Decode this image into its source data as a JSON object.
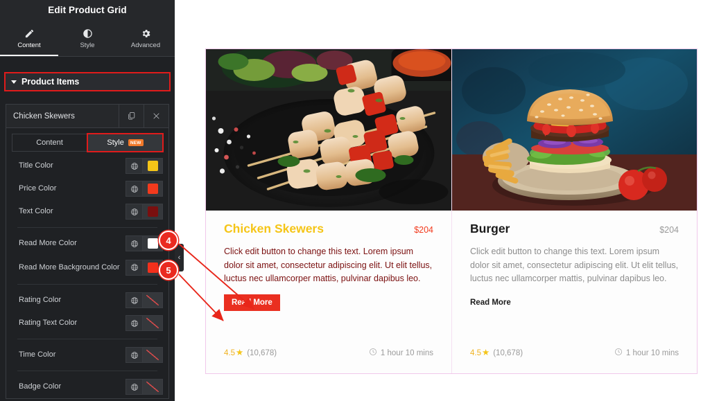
{
  "panel": {
    "title": "Edit Product Grid",
    "tabs": [
      {
        "label": "Content",
        "icon": "pencil-icon",
        "active": true
      },
      {
        "label": "Style",
        "icon": "contrast-icon",
        "active": false
      },
      {
        "label": "Advanced",
        "icon": "gear-icon",
        "active": false
      }
    ],
    "section": {
      "label": "Product Items",
      "caret": "caret-down-icon"
    },
    "item": {
      "name": "Chicken Skewers",
      "duplicate_icon": "duplicate-icon",
      "close_icon": "close-icon"
    },
    "subtabs": [
      {
        "label": "Content",
        "selected": false
      },
      {
        "label": "Style",
        "selected": true,
        "badge": "NEW"
      }
    ],
    "controls": [
      {
        "label": "Title Color",
        "swatch": "#f5c518",
        "empty": false,
        "divider_after": false
      },
      {
        "label": "Price Color",
        "swatch": "#f23a1d",
        "empty": false,
        "divider_after": false
      },
      {
        "label": "Text Color",
        "swatch": "#7a0f0f",
        "empty": false,
        "divider_after": true
      },
      {
        "label": "Read More Color",
        "swatch": "#ffffff",
        "empty": false,
        "divider_after": false
      },
      {
        "label": "Read More Background Color",
        "swatch": "#f2301c",
        "empty": false,
        "divider_after": true
      },
      {
        "label": "Rating Color",
        "swatch": "",
        "empty": true,
        "divider_after": false
      },
      {
        "label": "Rating Text Color",
        "swatch": "",
        "empty": true,
        "divider_after": true
      },
      {
        "label": "Time Color",
        "swatch": "",
        "empty": true,
        "divider_after": true
      },
      {
        "label": "Badge Color",
        "swatch": "",
        "empty": true,
        "divider_after": false
      }
    ],
    "collapse_handle": "‹"
  },
  "preview": {
    "cards": [
      {
        "image": "chicken-skewers-photo",
        "title": "Chicken Skewers",
        "price": "$204",
        "description": "Click edit button to change this text. Lorem ipsum dolor sit amet, consectetur adipiscing elit. Ut elit tellus, luctus nec ullamcorper mattis, pulvinar dapibus leo.",
        "read_more": "Read More",
        "rating_value": "4.5",
        "rating_star": "★",
        "rating_count": "(10,678)",
        "time": "1 hour 10 mins",
        "time_icon": "clock-icon",
        "styles": {
          "title_color": "#f5c518",
          "price_color": "#f23a1d",
          "text_color": "#7a0f0f",
          "read_more_color": "#ffffff",
          "read_more_bg": "#ea2f20"
        }
      },
      {
        "image": "burger-photo",
        "title": "Burger",
        "price": "$204",
        "description": "Click edit button to change this text. Lorem ipsum dolor sit amet, consectetur adipiscing elit. Ut elit tellus, luctus nec ullamcorper mattis, pulvinar dapibus leo.",
        "read_more": "Read More",
        "rating_value": "4.5",
        "rating_star": "★",
        "rating_count": "(10,678)",
        "time": "1 hour 10 mins",
        "time_icon": "clock-icon",
        "styles": {
          "title_color": "#1a1a1a",
          "price_color": "#9a9a9a",
          "text_color": "#8c8c8c",
          "read_more_color": "#1a1a1a",
          "read_more_bg": "transparent"
        }
      }
    ]
  },
  "annotations": {
    "badges": [
      {
        "number": "4",
        "target": "read-more-text-color"
      },
      {
        "number": "5",
        "target": "read-more-background-color"
      }
    ],
    "arrow_color": "#e8261a"
  }
}
